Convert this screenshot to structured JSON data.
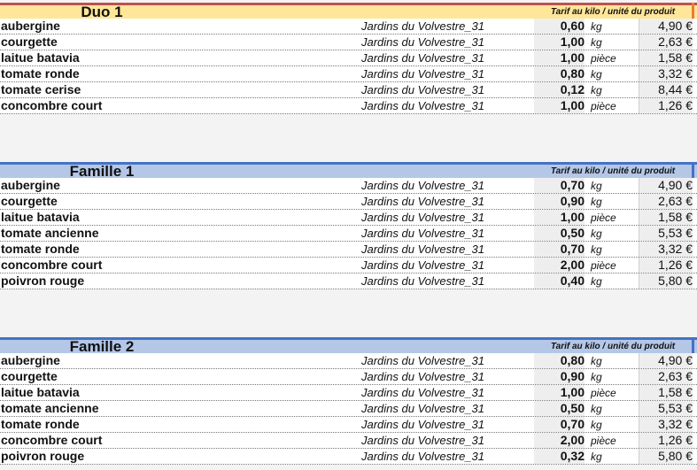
{
  "sections": [
    {
      "title": "Duo 1",
      "tarif_label": "Tarif au kilo / unité du produit",
      "header_color": "#ffe699",
      "border_color": "#c0504d",
      "edge_color": "#ed7d31",
      "rows": [
        {
          "product": "aubergine",
          "producer": "Jardins du Volvestre_31",
          "qty": "0,60",
          "unit": "kg",
          "price": "4,90 €"
        },
        {
          "product": "courgette",
          "producer": "Jardins du Volvestre_31",
          "qty": "1,00",
          "unit": "kg",
          "price": "2,63 €"
        },
        {
          "product": "laitue batavia",
          "producer": "Jardins du Volvestre_31",
          "qty": "1,00",
          "unit": "pièce",
          "price": "1,58 €"
        },
        {
          "product": "tomate ronde",
          "producer": "Jardins du Volvestre_31",
          "qty": "0,80",
          "unit": "kg",
          "price": "3,32 €"
        },
        {
          "product": "tomate cerise",
          "producer": "Jardins du Volvestre_31",
          "qty": "0,12",
          "unit": "kg",
          "price": "8,44 €"
        },
        {
          "product": "concombre court",
          "producer": "Jardins du Volvestre_31",
          "qty": "1,00",
          "unit": "pièce",
          "price": "1,26 €"
        }
      ]
    },
    {
      "title": "Famille 1",
      "tarif_label": "Tarif au kilo / unité du produit",
      "header_color": "#b4c7e7",
      "border_color": "#4472c4",
      "edge_color": "#4472c4",
      "rows": [
        {
          "product": "aubergine",
          "producer": "Jardins du Volvestre_31",
          "qty": "0,70",
          "unit": "kg",
          "price": "4,90 €"
        },
        {
          "product": "courgette",
          "producer": "Jardins du Volvestre_31",
          "qty": "0,90",
          "unit": "kg",
          "price": "2,63 €"
        },
        {
          "product": "laitue batavia",
          "producer": "Jardins du Volvestre_31",
          "qty": "1,00",
          "unit": "pièce",
          "price": "1,58 €"
        },
        {
          "product": "tomate ancienne",
          "producer": "Jardins du Volvestre_31",
          "qty": "0,50",
          "unit": "kg",
          "price": "5,53 €"
        },
        {
          "product": "tomate ronde",
          "producer": "Jardins du Volvestre_31",
          "qty": "0,70",
          "unit": "kg",
          "price": "3,32 €"
        },
        {
          "product": "concombre court",
          "producer": "Jardins du Volvestre_31",
          "qty": "2,00",
          "unit": "pièce",
          "price": "1,26 €"
        },
        {
          "product": "poivron rouge",
          "producer": "Jardins du Volvestre_31",
          "qty": "0,40",
          "unit": "kg",
          "price": "5,80 €"
        }
      ]
    },
    {
      "title": "Famille 2",
      "tarif_label": "Tarif au kilo / unité du produit",
      "header_color": "#b4c7e7",
      "border_color": "#4472c4",
      "edge_color": "#4472c4",
      "rows": [
        {
          "product": "aubergine",
          "producer": "Jardins du Volvestre_31",
          "qty": "0,80",
          "unit": "kg",
          "price": "4,90 €"
        },
        {
          "product": "courgette",
          "producer": "Jardins du Volvestre_31",
          "qty": "0,90",
          "unit": "kg",
          "price": "2,63 €"
        },
        {
          "product": "laitue batavia",
          "producer": "Jardins du Volvestre_31",
          "qty": "1,00",
          "unit": "pièce",
          "price": "1,58 €"
        },
        {
          "product": "tomate ancienne",
          "producer": "Jardins du Volvestre_31",
          "qty": "0,50",
          "unit": "kg",
          "price": "5,53 €"
        },
        {
          "product": "tomate ronde",
          "producer": "Jardins du Volvestre_31",
          "qty": "0,70",
          "unit": "kg",
          "price": "3,32 €"
        },
        {
          "product": "concombre court",
          "producer": "Jardins du Volvestre_31",
          "qty": "2,00",
          "unit": "pièce",
          "price": "1,26 €"
        },
        {
          "product": "poivron rouge",
          "producer": "Jardins du Volvestre_31",
          "qty": "0,32",
          "unit": "kg",
          "price": "5,80 €"
        }
      ]
    }
  ]
}
